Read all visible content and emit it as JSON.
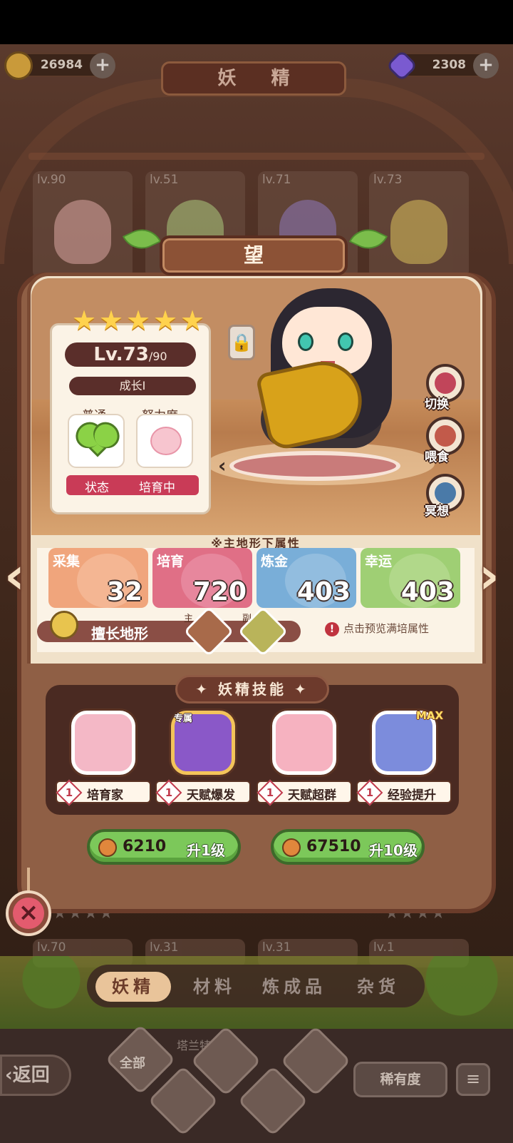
{
  "currencies": {
    "gold": {
      "amount": "26984",
      "icon": "gold-coin-icon"
    },
    "gem": {
      "amount": "2308",
      "icon": "purple-gem-icon"
    }
  },
  "screen_title": "妖 精",
  "background_roster": {
    "top_row": [
      "lv.90",
      "lv.51",
      "lv.71",
      "lv.73"
    ],
    "bottom_row": [
      "lv.70",
      "lv.31",
      "lv.31",
      "lv.1"
    ]
  },
  "fairy": {
    "name": "望",
    "stars": 5,
    "level_current": "Lv.73",
    "level_max": "/90",
    "growth": "成长I",
    "mood_label": "普通",
    "effort_label": "努力度",
    "status_label": "状态",
    "status_value": "培育中"
  },
  "side_actions": [
    {
      "label": "切换",
      "icon": "switch-icon"
    },
    {
      "label": "喂食",
      "icon": "meat-icon"
    },
    {
      "label": "冥想",
      "icon": "meditate-icon"
    }
  ],
  "stats": {
    "header": "※主地形下属性",
    "items": [
      {
        "name": "采集",
        "value": "32",
        "color": "#f0a57c"
      },
      {
        "name": "培育",
        "value": "720",
        "color": "#e06f86"
      },
      {
        "name": "炼金",
        "value": "403",
        "color": "#79aed8"
      },
      {
        "name": "幸运",
        "value": "403",
        "color": "#9fcf74"
      }
    ],
    "terrain_label": "擅长地形",
    "terrain_main_tag": "主",
    "terrain_sub_tag": "副",
    "preview_hint": "点击预览满培属性"
  },
  "skills": {
    "title": "✦ 妖精技能 ✦",
    "exclusive_tag": "专属",
    "max_tag": "MAX",
    "items": [
      {
        "level": "1",
        "name": "培育家",
        "icon": "watering-can-icon"
      },
      {
        "level": "1",
        "name": "天赋爆发",
        "icon": "talent-burst-icon"
      },
      {
        "level": "1",
        "name": "天赋超群",
        "icon": "talent-excel-icon"
      },
      {
        "level": "1",
        "name": "经验提升",
        "icon": "exp-boost-icon"
      }
    ]
  },
  "upgrade": {
    "one": {
      "cost": "6210",
      "label": "升1级"
    },
    "ten": {
      "cost": "67510",
      "label": "升10级"
    }
  },
  "tabs": [
    "妖精",
    "材料",
    "炼成品",
    "杂货"
  ],
  "active_tab": 0,
  "bottom": {
    "back_label": "返回",
    "filter_all": "全部",
    "rarity_label": "稀有度",
    "partial_name": "塔兰特"
  }
}
